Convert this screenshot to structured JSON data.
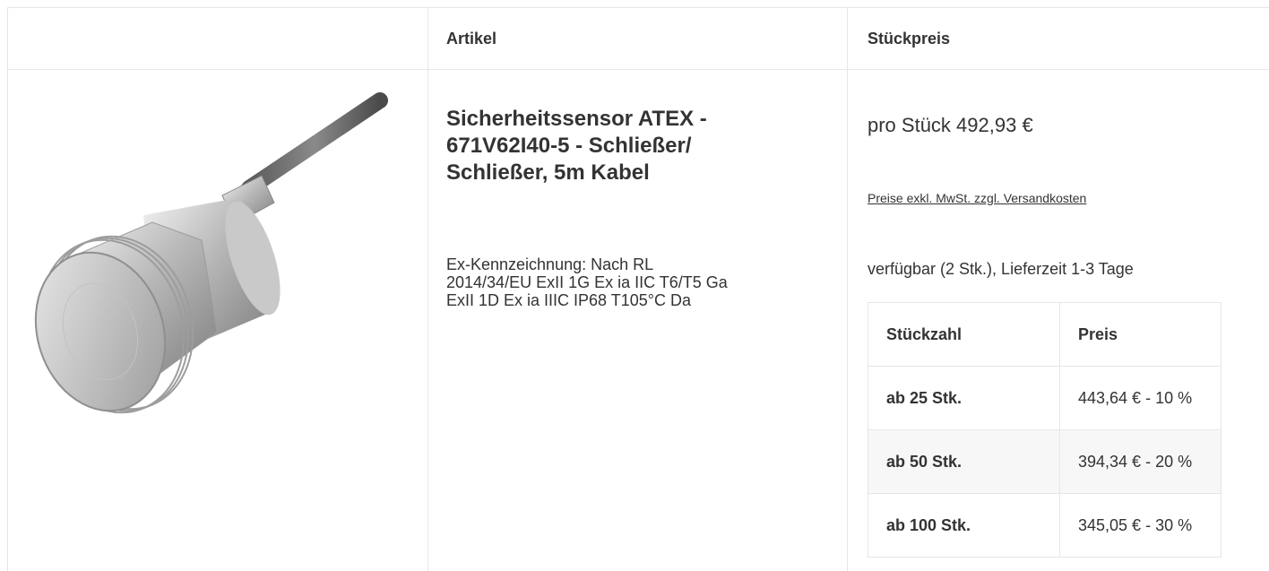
{
  "header": {
    "col_article": "Artikel",
    "col_price": "Stückpreis"
  },
  "product": {
    "image_icon": "cylindrical-sensor-with-cable-icon",
    "title_lines": [
      "Sicherheitssensor ATEX -",
      "671V62I40-5 - Schließer/",
      "Schließer, 5m Kabel"
    ],
    "description_lines": [
      "Ex-Kennzeichnung: Nach RL",
      "2014/34/EU ExII 1G Ex ia IIC T6/T5 Ga",
      "ExII 1D Ex ia IIIC IP68 T105°C Da"
    ]
  },
  "pricing": {
    "unit_price": "pro Stück 492,93 €",
    "note_link": "Preise exkl. MwSt. zzgl. Versandkosten",
    "availability": "verfügbar (2 Stk.), Lieferzeit 1-3 Tage",
    "tier_headers": {
      "qty": "Stückzahl",
      "price": "Preis"
    },
    "tiers": [
      {
        "qty": "ab 25 Stk.",
        "price": "443,64 € - 10 %"
      },
      {
        "qty": "ab 50 Stk.",
        "price": "394,34 € - 20 %"
      },
      {
        "qty": "ab 100 Stk.",
        "price": "345,05 € - 30 %"
      }
    ]
  },
  "colors": {
    "border": "#e6e6e6",
    "text": "#333333",
    "alt_row": "#f7f7f7"
  }
}
